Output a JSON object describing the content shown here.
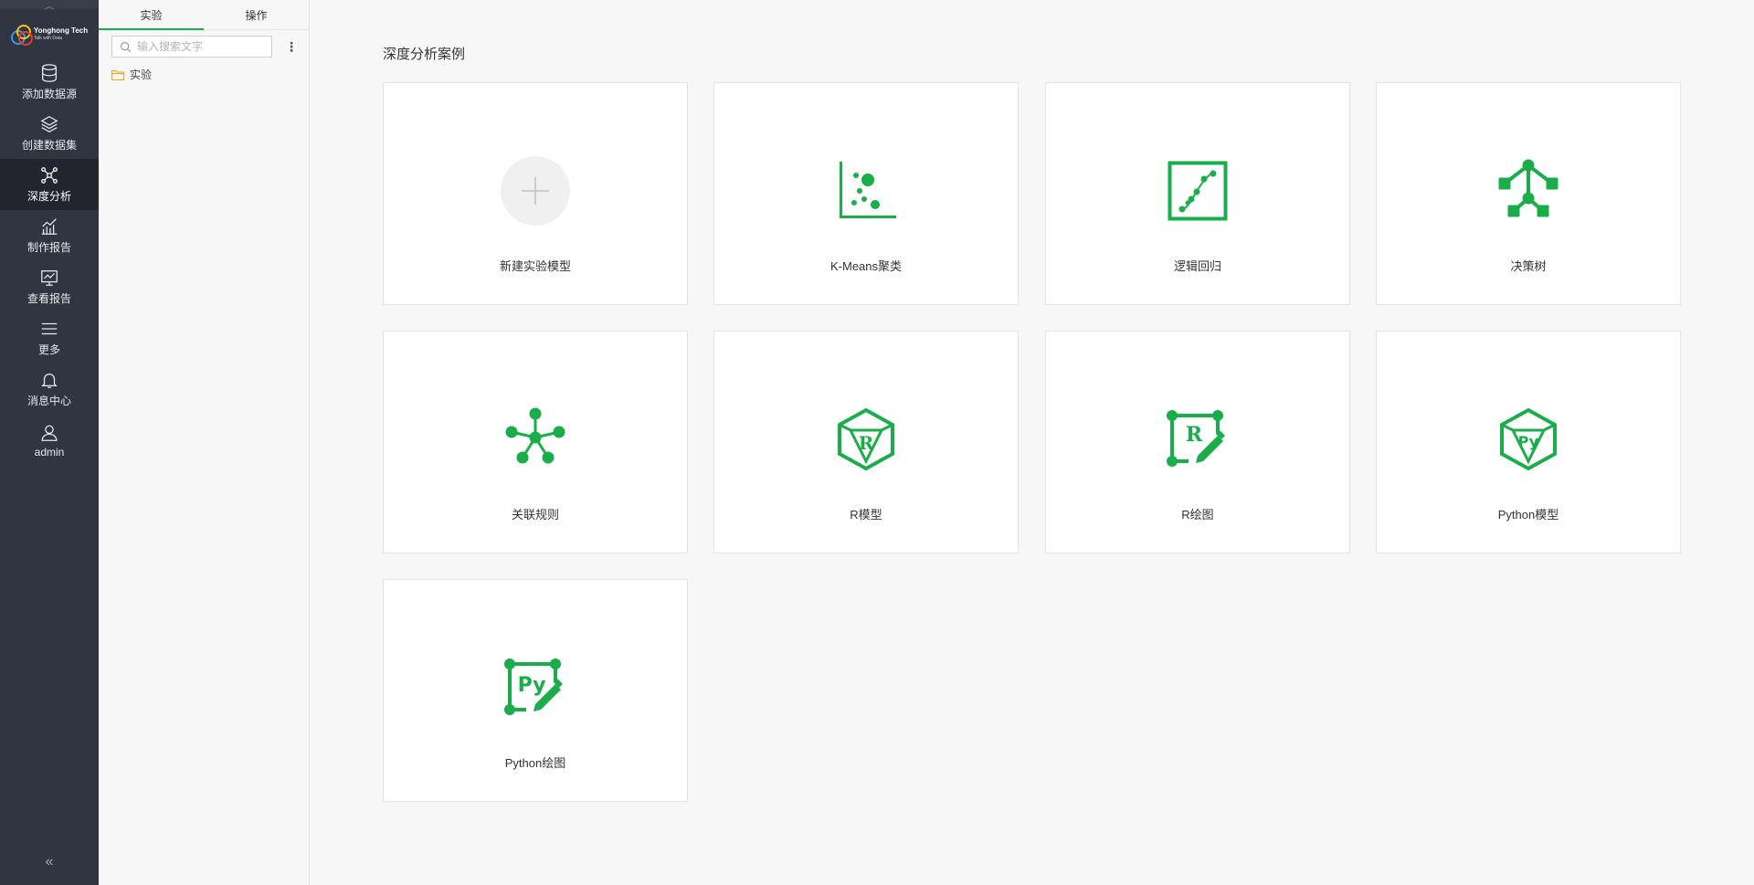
{
  "brand": {
    "name": "Yonghong Tech",
    "tagline": "Talk with Data"
  },
  "nav": {
    "items": [
      {
        "label": "添加数据源",
        "icon": "database-icon"
      },
      {
        "label": "创建数据集",
        "icon": "layers-icon"
      },
      {
        "label": "深度分析",
        "icon": "network-icon",
        "active": true
      },
      {
        "label": "制作报告",
        "icon": "chart-icon"
      },
      {
        "label": "查看报告",
        "icon": "monitor-icon"
      },
      {
        "label": "更多",
        "icon": "menu-icon"
      },
      {
        "label": "消息中心",
        "icon": "bell-icon"
      },
      {
        "label": "admin",
        "icon": "user-icon"
      }
    ],
    "collapse_glyph": "«"
  },
  "panel": {
    "tabs": [
      {
        "label": "实验",
        "active": true
      },
      {
        "label": "操作"
      }
    ],
    "search_placeholder": "输入搜索文字",
    "tree": [
      {
        "label": "实验",
        "icon": "folder-icon"
      }
    ]
  },
  "main": {
    "title": "深度分析案例",
    "cards": [
      {
        "label": "新建实验模型",
        "icon": "plus-icon"
      },
      {
        "label": "K-Means聚类",
        "icon": "scatter-icon"
      },
      {
        "label": "逻辑回归",
        "icon": "regression-icon"
      },
      {
        "label": "决策树",
        "icon": "tree-icon"
      },
      {
        "label": "关联规则",
        "icon": "association-icon"
      },
      {
        "label": "R模型",
        "icon": "r-model-icon",
        "badge": "R"
      },
      {
        "label": "R绘图",
        "icon": "r-plot-icon",
        "badge": "R"
      },
      {
        "label": "Python模型",
        "icon": "python-model-icon",
        "badge": "Py"
      },
      {
        "label": "Python绘图",
        "icon": "python-plot-icon",
        "badge": "Py"
      }
    ]
  },
  "colors": {
    "accent": "#1aae4a",
    "nav_bg": "#313541",
    "nav_active": "#22252e"
  }
}
